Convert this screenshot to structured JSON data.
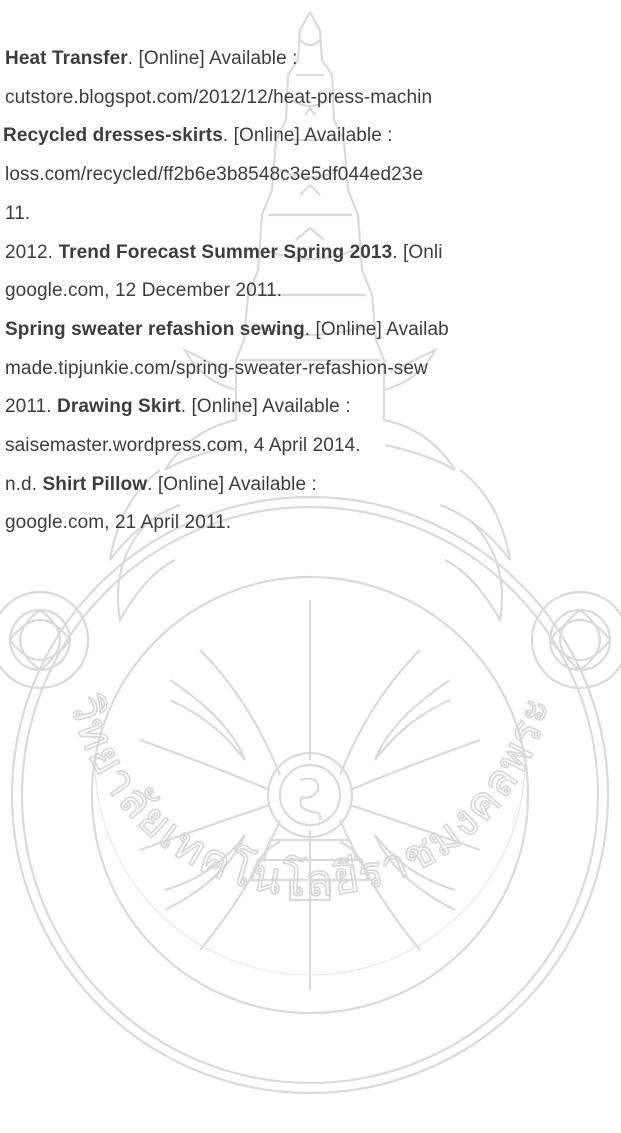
{
  "watermark": {
    "emblem": "rmutp-university-seal",
    "lettering": "มหาวิทยาลัยเทคโนโลยีราชมงคลพระนคร",
    "color": "#d9d9d9"
  },
  "references": [
    {
      "pre": "",
      "title": "Heat Transfer",
      "post": ". [Online] Available :"
    },
    {
      "pre": "cutstore.blogspot.com/2012/12/heat-press-machin",
      "title": "",
      "post": ""
    },
    {
      "pre": "",
      "title": "Recycled dresses-skirts",
      "post": ". [Online] Available :"
    },
    {
      "pre": "loss.com/recycled/ff2b6e3b8548c3e5df044ed23e",
      "title": "",
      "post": ""
    },
    {
      "pre": "11.",
      "title": "",
      "post": ""
    },
    {
      "pre": "2012. ",
      "title": "Trend Forecast Summer Spring 2013",
      "post": ". [Onli"
    },
    {
      "pre": "google.com, 12 December 2011.",
      "title": "",
      "post": ""
    },
    {
      "pre": "",
      "title": "Spring sweater refashion sewing",
      "post": ". [Online] Availab"
    },
    {
      "pre": "made.tipjunkie.com/spring-sweater-refashion-sew",
      "title": "",
      "post": ""
    },
    {
      "pre": "2011. ",
      "title": "Drawing Skirt",
      "post": ". [Online] Available :"
    },
    {
      "pre": "saisemaster.wordpress.com, 4 April 2014.",
      "title": "",
      "post": ""
    },
    {
      "pre": "n.d. ",
      "title": "Shirt Pillow",
      "post": ". [Online] Available :"
    },
    {
      "pre": "google.com, 21 April 2011.",
      "title": "",
      "post": ""
    }
  ]
}
